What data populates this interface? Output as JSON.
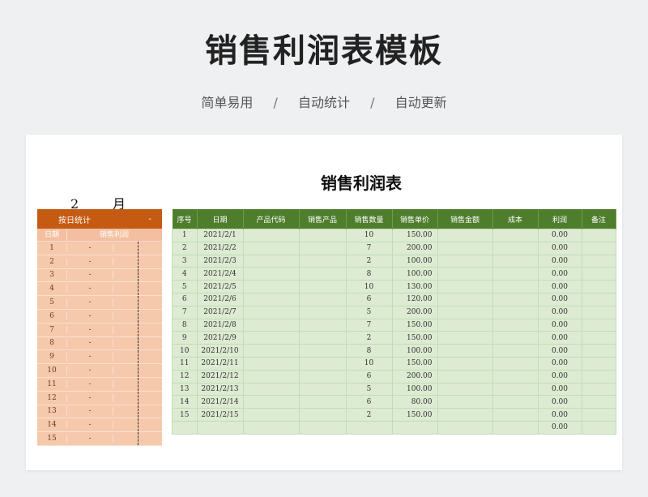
{
  "header": {
    "title": "销售利润表模板",
    "tags": [
      "简单易用",
      "自动统计",
      "自动更新"
    ],
    "separator": "/"
  },
  "sheet": {
    "title": "销售利润表",
    "month_value": "2",
    "month_unit": "月"
  },
  "left_panel": {
    "header_label": "按日统计",
    "header_value": "-",
    "col_day": "日期",
    "col_profit": "销售利润",
    "rows": [
      {
        "day": "1",
        "profit": "-"
      },
      {
        "day": "2",
        "profit": "-"
      },
      {
        "day": "3",
        "profit": "-"
      },
      {
        "day": "4",
        "profit": "-"
      },
      {
        "day": "5",
        "profit": "-"
      },
      {
        "day": "6",
        "profit": "-"
      },
      {
        "day": "7",
        "profit": "-"
      },
      {
        "day": "8",
        "profit": "-"
      },
      {
        "day": "9",
        "profit": "-"
      },
      {
        "day": "10",
        "profit": "-"
      },
      {
        "day": "11",
        "profit": "-"
      },
      {
        "day": "12",
        "profit": "-"
      },
      {
        "day": "13",
        "profit": "-"
      },
      {
        "day": "14",
        "profit": "-"
      },
      {
        "day": "15",
        "profit": "-"
      }
    ]
  },
  "table": {
    "columns": [
      "序号",
      "日期",
      "产品代码",
      "销售产品",
      "销售数量",
      "销售单价",
      "销售金额",
      "成本",
      "利润",
      "备注"
    ],
    "rows": [
      {
        "no": "1",
        "date": "2021/2/1",
        "qty": "10",
        "price": "150.00",
        "profit": "0.00"
      },
      {
        "no": "2",
        "date": "2021/2/2",
        "qty": "7",
        "price": "200.00",
        "profit": "0.00"
      },
      {
        "no": "3",
        "date": "2021/2/3",
        "qty": "2",
        "price": "100.00",
        "profit": "0.00"
      },
      {
        "no": "4",
        "date": "2021/2/4",
        "qty": "8",
        "price": "100.00",
        "profit": "0.00"
      },
      {
        "no": "5",
        "date": "2021/2/5",
        "qty": "10",
        "price": "130.00",
        "profit": "0.00"
      },
      {
        "no": "6",
        "date": "2021/2/6",
        "qty": "6",
        "price": "120.00",
        "profit": "0.00"
      },
      {
        "no": "7",
        "date": "2021/2/7",
        "qty": "5",
        "price": "200.00",
        "profit": "0.00"
      },
      {
        "no": "8",
        "date": "2021/2/8",
        "qty": "7",
        "price": "150.00",
        "profit": "0.00"
      },
      {
        "no": "9",
        "date": "2021/2/9",
        "qty": "2",
        "price": "150.00",
        "profit": "0.00"
      },
      {
        "no": "10",
        "date": "2021/2/10",
        "qty": "8",
        "price": "100.00",
        "profit": "0.00"
      },
      {
        "no": "11",
        "date": "2021/2/11",
        "qty": "10",
        "price": "150.00",
        "profit": "0.00"
      },
      {
        "no": "12",
        "date": "2021/2/12",
        "qty": "6",
        "price": "200.00",
        "profit": "0.00"
      },
      {
        "no": "13",
        "date": "2021/2/13",
        "qty": "5",
        "price": "100.00",
        "profit": "0.00"
      },
      {
        "no": "14",
        "date": "2021/2/14",
        "qty": "6",
        "price": "80.00",
        "profit": "0.00"
      },
      {
        "no": "15",
        "date": "2021/2/15",
        "qty": "2",
        "price": "150.00",
        "profit": "0.00"
      },
      {
        "no": "",
        "date": "",
        "qty": "",
        "price": "",
        "profit": "0.00"
      }
    ]
  },
  "colors": {
    "orange_header": "#c55a12",
    "orange_fill": "#f6c9ac",
    "green_header": "#4e7d2c",
    "green_fill": "#dcebd2"
  }
}
